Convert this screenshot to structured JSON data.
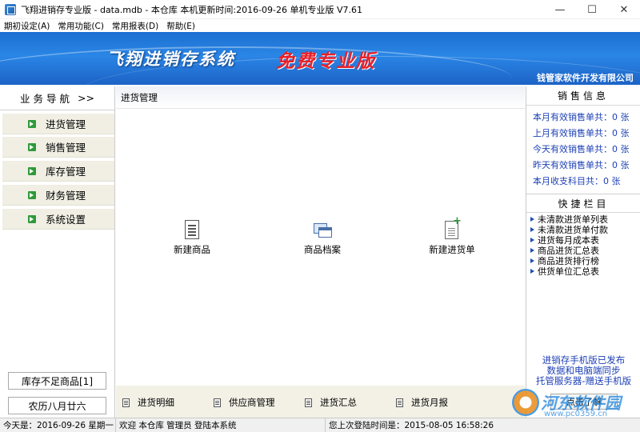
{
  "window": {
    "title": "飞翔进销存专业版 - data.mdb - 本仓库  本机更新时间:2016-09-26 单机专业版 V7.61",
    "minimize": "—",
    "maximize": "☐",
    "close": "✕"
  },
  "menu": [
    "期初设定(A)",
    "常用功能(C)",
    "常用报表(D)",
    "帮助(E)"
  ],
  "banner": {
    "system_title": "飞翔进销存系统",
    "edition": "免费专业版",
    "company": "钱管家软件开发有限公司"
  },
  "sidebar": {
    "header": "业务导航",
    "header_arrows": ">>",
    "items": [
      "进货管理",
      "销售管理",
      "库存管理",
      "财务管理",
      "系统设置"
    ],
    "low_stock_button": "库存不足商品[1]",
    "lunar_date": "农历八月廿六"
  },
  "center": {
    "title": "进货管理",
    "actions": [
      "新建商品",
      "商品档案",
      "新建进货单"
    ],
    "bottom_links": [
      "进货明细",
      "供应商管理",
      "进货汇总",
      "进货月报"
    ]
  },
  "right": {
    "sales_header": "销售信息",
    "sales_rows": [
      "本月有效销售单共：0 张",
      "上月有效销售单共：0 张",
      "今天有效销售单共：0 张",
      "昨天有效销售单共：0 张",
      "本月收支科目共：0 张"
    ],
    "quick_header": "快捷栏目",
    "quick_items": [
      "未清款进货单列表",
      "未清款进货单付款",
      "进货每月成本表",
      "商品进货汇总表",
      "商品进货排行榜",
      "供货单位汇总表"
    ],
    "promo": [
      "进销存手机版已发布",
      "数据和电脑端同步",
      "托管服务器-赠送手机版"
    ],
    "promo_button": "点击了解"
  },
  "status": {
    "today": "今天是：2016-09-26  星期一",
    "welcome": "欢迎 本仓库 管理员  登陆本系统",
    "last_login": "您上次登陆时间是：2015-08-05 16:58:26"
  },
  "watermark": {
    "brand": "河东软件园",
    "url": "www.pc0359.cn"
  }
}
